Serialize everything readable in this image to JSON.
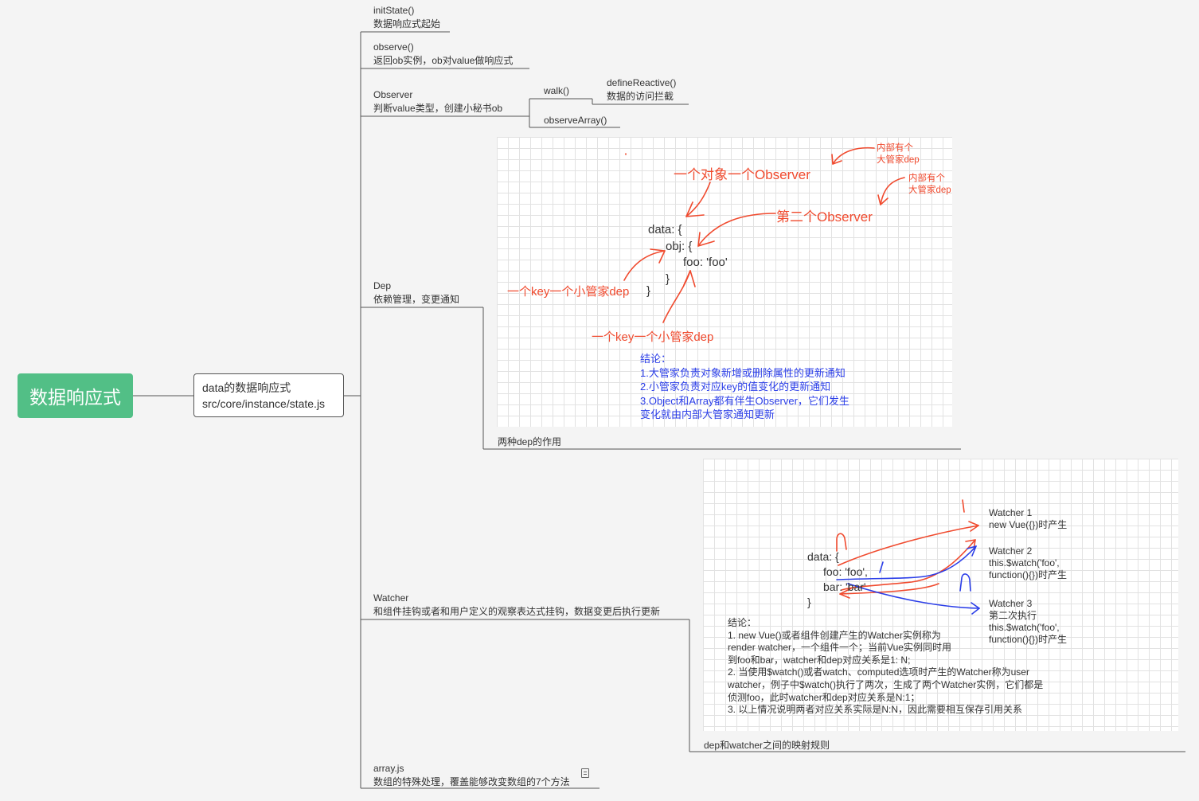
{
  "root": {
    "label": "数据响应式"
  },
  "level1": {
    "line1": "data的数据响应式",
    "line2": "src/core/instance/state.js"
  },
  "children": {
    "initState": {
      "title": "initState()",
      "desc": "数据响应式起始"
    },
    "observe": {
      "title": "observe()",
      "desc": "返回ob实例，ob对value做响应式"
    },
    "observer": {
      "title": "Observer",
      "desc": "判断value类型，创建小秘书ob"
    },
    "walk": {
      "title": "walk()"
    },
    "defineReactive": {
      "title": "defineReactive()",
      "desc": "数据的访问拦截"
    },
    "observeArray": {
      "title": "observeArray()"
    },
    "dep": {
      "title": "Dep",
      "desc": "依赖管理，变更通知"
    },
    "dep_caption": "两种dep的作用",
    "watcher": {
      "title": "Watcher",
      "desc": "和组件挂钩或者和用户定义的观察表达式挂钩，数据变更后执行更新"
    },
    "watcher_caption": "dep和watcher之间的映射规则",
    "arrayjs": {
      "title": "array.js",
      "desc": "数组的特殊处理，覆盖能够改变数组的7个方法"
    }
  },
  "dep_image": {
    "code": [
      "data: {",
      "obj: {",
      "foo: 'foo'",
      "}",
      "}"
    ],
    "annotations": {
      "object_observer": "一个对象一个Observer",
      "inner_dep_1a": "内部有个",
      "inner_dep_1b": "大管家dep",
      "second_observer": "第二个Observer",
      "inner_dep_2a": "内部有个",
      "inner_dep_2b": "大管家dep",
      "key_dep_1": "一个key一个小管家dep",
      "key_dep_2": "一个key一个小管家dep"
    },
    "conclusion": [
      "结论：",
      "1.大管家负责对象新增或删除属性的更新通知",
      "2.小管家负责对应key的值变化的更新通知",
      "3.Object和Array都有伴生Observer，它们发生",
      "变化就由内部大管家通知更新"
    ]
  },
  "watcher_image": {
    "code": [
      "data: {",
      "foo: 'foo',",
      "bar: 'bar'",
      "}"
    ],
    "marks": {
      "n1": "n",
      "one1": "/",
      "one2": "/",
      "n2": "n"
    },
    "watchers": [
      {
        "lines": [
          "Watcher 1",
          "new Vue({})时产生"
        ]
      },
      {
        "lines": [
          "Watcher 2",
          "this.$watch('foo',",
          "function(){})时产生"
        ]
      },
      {
        "lines": [
          "Watcher 3",
          "第二次执行",
          "this.$watch('foo',",
          "function(){})时产生"
        ]
      }
    ],
    "conclusion": [
      "结论：",
      "1. new Vue()或者组件创建产生的Watcher实例称为",
      "render watcher，一个组件一个；当前Vue实例同时用",
      "到foo和bar，watcher和dep对应关系是1: N;",
      "2. 当使用$watch()或者watch、computed选项时产生的Watcher称为user",
      "watcher，例子中$watch()执行了两次，生成了两个Watcher实例，它们都是",
      "侦测foo，此时watcher和dep对应关系是N:1；",
      "3. 以上情况说明两者对应关系实际是N:N，因此需要相互保存引用关系"
    ]
  },
  "colors": {
    "root": "#52bf86",
    "red": "#f04a2e",
    "blue": "#2b3ee8"
  }
}
